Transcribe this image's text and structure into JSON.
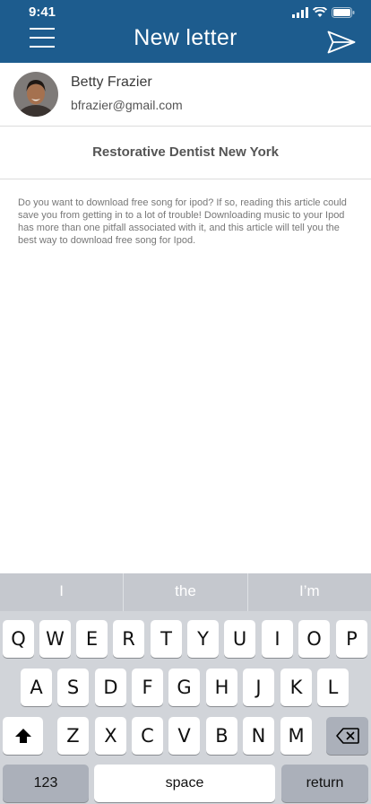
{
  "status": {
    "time": "9:41"
  },
  "header": {
    "title": "New letter"
  },
  "sender": {
    "name": "Betty Frazier",
    "email": "bfrazier@gmail.com"
  },
  "subject": "Restorative Dentist New York",
  "body": "Do you want to download free song for ipod? If so, reading this article could save you from getting in to a lot of trouble! Downloading music to your Ipod has more than one pitfall associated with it, and this article will tell you the best way to download free song for Ipod.",
  "keyboard": {
    "suggestions": [
      "I",
      "the",
      "I’m"
    ],
    "row1": [
      "Q",
      "W",
      "E",
      "R",
      "T",
      "Y",
      "U",
      "I",
      "O",
      "P"
    ],
    "row2": [
      "A",
      "S",
      "D",
      "F",
      "G",
      "H",
      "J",
      "K",
      "L"
    ],
    "row3": [
      "Z",
      "X",
      "C",
      "V",
      "B",
      "N",
      "M"
    ],
    "numbers_label": "123",
    "space_label": "space",
    "return_label": "return"
  },
  "colors": {
    "header_bg": "#1d5c8e",
    "keyboard_bg": "#d1d4d9"
  }
}
